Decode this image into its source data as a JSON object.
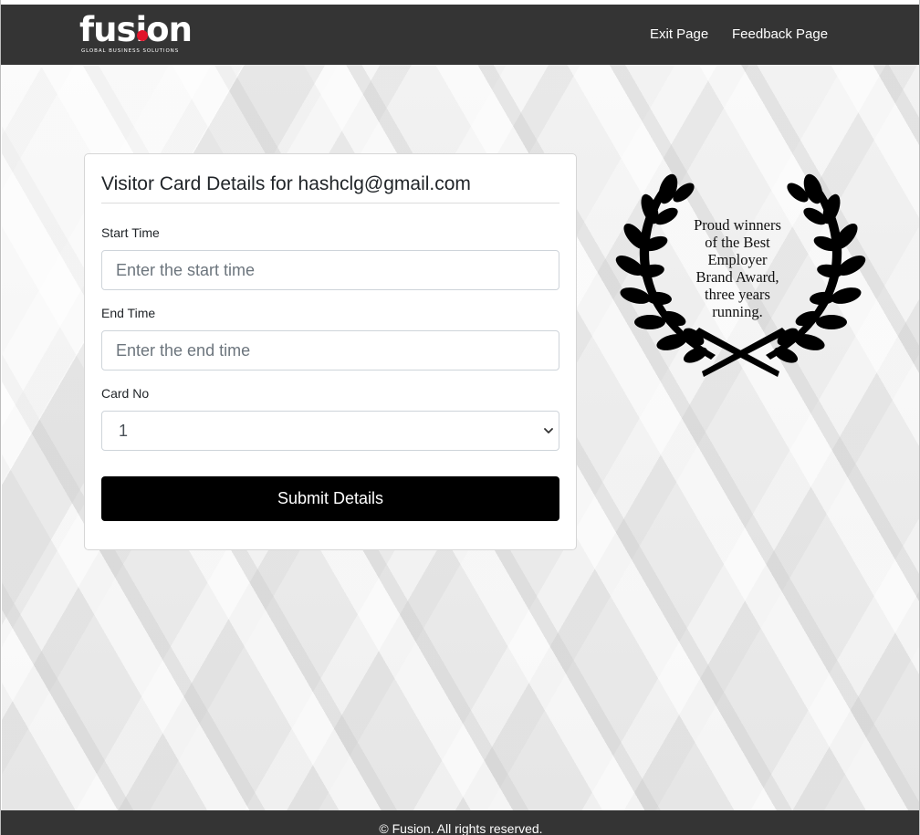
{
  "header": {
    "logo": {
      "word": "fusion",
      "tagline": "GLOBAL BUSINESS SOLUTIONS",
      "dot_color": "#e0142b"
    },
    "nav": [
      {
        "label": "Exit Page"
      },
      {
        "label": "Feedback Page"
      }
    ],
    "background_color": "#343434"
  },
  "form": {
    "title": "Visitor Card Details for hashclg@gmail.com",
    "start_time": {
      "label": "Start Time",
      "placeholder": "Enter the start time",
      "value": ""
    },
    "end_time": {
      "label": "End Time",
      "placeholder": "Enter the end time",
      "value": ""
    },
    "card_no": {
      "label": "Card No",
      "selected": "1"
    },
    "submit_label": "Submit Details",
    "submit_color": "#000000"
  },
  "award": {
    "lines": [
      "Proud winners",
      "of the Best",
      "Employer",
      "Brand Award,",
      "three years",
      "running."
    ],
    "icon": "laurel-wreath-icon"
  },
  "footer": {
    "text": "© Fusion. All rights reserved."
  }
}
